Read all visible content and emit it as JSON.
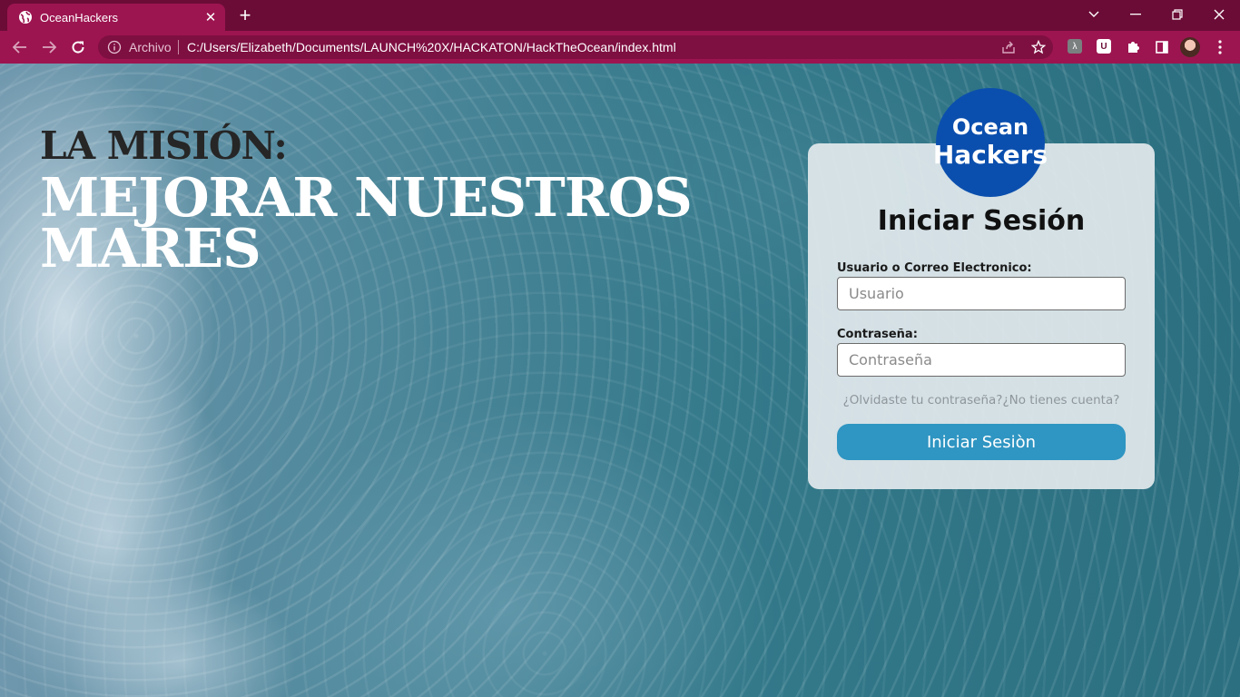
{
  "browser": {
    "tab_title": "OceanHackers",
    "scheme_label": "Archivo",
    "url": "C:/Users/Elizabeth/Documents/LAUNCH%20X/HACKATON/HackTheOcean/index.html"
  },
  "hero": {
    "line1": "LA MISIÓN:",
    "line2": "MEJORAR NUESTROS MARES"
  },
  "login": {
    "logo_line1": "Ocean",
    "logo_line2": "Hackers",
    "title": "Iniciar Sesión",
    "username_label": "Usuario o Correo Electronico:",
    "username_placeholder": "Usuario",
    "password_label": "Contraseña:",
    "password_placeholder": "Contraseña",
    "forgot_link": "¿Olvidaste tu contraseña?",
    "signup_link": "¿No tienes cuenta?",
    "submit_label": "Iniciar Sesiòn"
  },
  "colors": {
    "browser_frame": "#6b0c36",
    "browser_toolbar": "#9c1550",
    "logo_blue": "#0b4fae",
    "button_blue": "#2f95c2"
  },
  "icons": {
    "favicon": "globe-icon",
    "nav": [
      "back-arrow-icon",
      "forward-arrow-icon",
      "reload-icon"
    ],
    "omnibox": [
      "info-icon",
      "share-icon",
      "star-icon"
    ],
    "extensions": [
      "lambda-extension-icon",
      "shield-extension-icon",
      "puzzle-icon",
      "sidepanel-icon"
    ]
  }
}
